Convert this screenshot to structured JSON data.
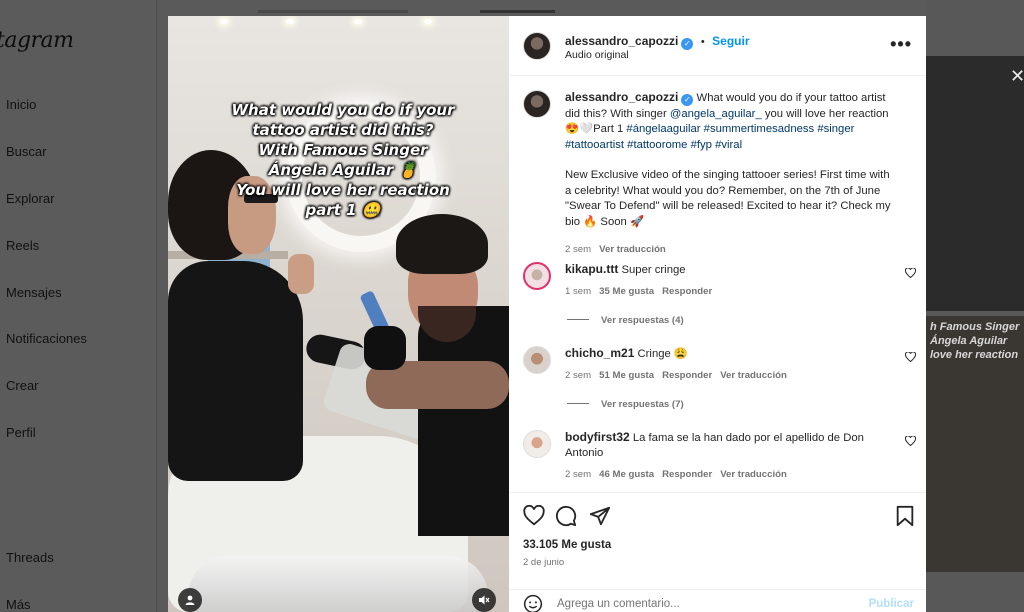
{
  "sidebar": {
    "logo": "tagram",
    "items": [
      "Inicio",
      "Buscar",
      "Explorar",
      "Reels",
      "Mensajes",
      "Notificaciones",
      "Crear",
      "Perfil"
    ],
    "bottom_items": [
      "Threads",
      "Más"
    ]
  },
  "background_card": {
    "overlay_text": "h Famous Singer\nÁngela Aguilar\nlove her reaction"
  },
  "video": {
    "overlay_text": "What would you do if your tattoo artist did this?\nWith Famous Singer\nÁngela Aguilar 🍍\nYou will love her reaction\npart 1 🤐",
    "icons": [
      "user-tag-icon",
      "mute-icon"
    ]
  },
  "post": {
    "username": "alessandro_capozzi",
    "verified_icon": "verified-badge-icon",
    "follow_label": "Seguir",
    "audio_label": "Audio original",
    "more_icon": "more-options-icon"
  },
  "caption": {
    "username": "alessandro_capozzi",
    "text_1": "What would you do if your tattoo artist did this? With singer",
    "mention": "@angela_aguilar_",
    "text_2": "you will love her reaction 😍🤍Part 1",
    "hashtags": "#ángelaaguilar #summertimesadness #singer #tattooartist #tattoorome #fyp #viral",
    "paragraph_2": "New Exclusive video of the singing tattooer series! First time with a celebrity! What would you do? Remember, on the 7th of June \"Swear To Defend\" will be released! Excited to hear it? Check my bio 🔥 Soon 🚀",
    "time": "2 sem",
    "translate": "Ver traducción"
  },
  "comments": [
    {
      "username": "kikapu.ttt",
      "text": "Super cringe",
      "time": "1 sem",
      "likes": "35 Me gusta",
      "reply": "Responder",
      "translate": "",
      "replies_label": "Ver respuestas (4)"
    },
    {
      "username": "chicho_m21",
      "text": "Cringe 😩",
      "time": "2 sem",
      "likes": "51 Me gusta",
      "reply": "Responder",
      "translate": "Ver traducción",
      "replies_label": "Ver respuestas (7)"
    },
    {
      "username": "bodyfirst32",
      "text": "La fama se la han dado por el apellido de Don Antonio",
      "time": "2 sem",
      "likes": "46 Me gusta",
      "reply": "Responder",
      "translate": "Ver traducción",
      "replies_label": ""
    }
  ],
  "actions": {
    "icons": [
      "heart-icon",
      "comment-icon",
      "share-icon",
      "save-icon"
    ],
    "likes_count": "33.105 Me gusta",
    "date": "2 de junio"
  },
  "comment_input": {
    "placeholder": "Agrega un comentario...",
    "post_label": "Publicar",
    "emoji_icon": "emoji-icon"
  },
  "colors": {
    "accent": "#0095f6",
    "hashtag": "#00376b",
    "overlay": "#5a5a5a",
    "muted_text": "#737373"
  }
}
